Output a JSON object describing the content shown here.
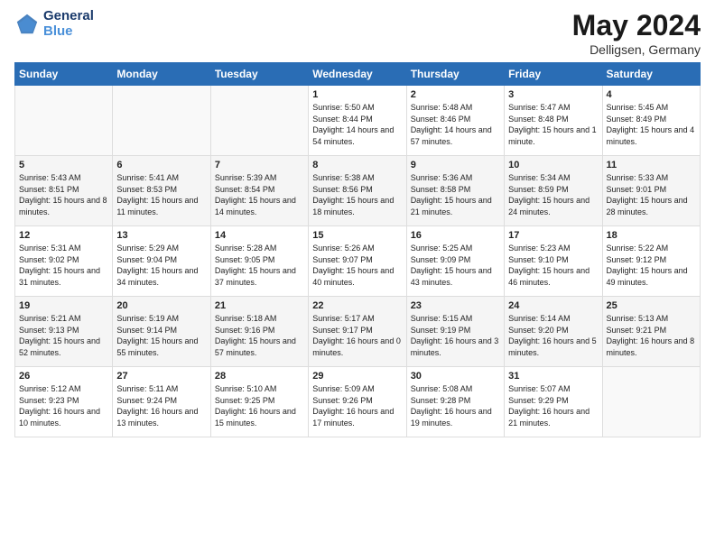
{
  "header": {
    "logo_line1": "General",
    "logo_line2": "Blue",
    "title": "May 2024",
    "subtitle": "Delligsen, Germany"
  },
  "days_of_week": [
    "Sunday",
    "Monday",
    "Tuesday",
    "Wednesday",
    "Thursday",
    "Friday",
    "Saturday"
  ],
  "weeks": [
    [
      {
        "num": "",
        "sunrise": "",
        "sunset": "",
        "daylight": ""
      },
      {
        "num": "",
        "sunrise": "",
        "sunset": "",
        "daylight": ""
      },
      {
        "num": "",
        "sunrise": "",
        "sunset": "",
        "daylight": ""
      },
      {
        "num": "1",
        "sunrise": "Sunrise: 5:50 AM",
        "sunset": "Sunset: 8:44 PM",
        "daylight": "Daylight: 14 hours and 54 minutes."
      },
      {
        "num": "2",
        "sunrise": "Sunrise: 5:48 AM",
        "sunset": "Sunset: 8:46 PM",
        "daylight": "Daylight: 14 hours and 57 minutes."
      },
      {
        "num": "3",
        "sunrise": "Sunrise: 5:47 AM",
        "sunset": "Sunset: 8:48 PM",
        "daylight": "Daylight: 15 hours and 1 minute."
      },
      {
        "num": "4",
        "sunrise": "Sunrise: 5:45 AM",
        "sunset": "Sunset: 8:49 PM",
        "daylight": "Daylight: 15 hours and 4 minutes."
      }
    ],
    [
      {
        "num": "5",
        "sunrise": "Sunrise: 5:43 AM",
        "sunset": "Sunset: 8:51 PM",
        "daylight": "Daylight: 15 hours and 8 minutes."
      },
      {
        "num": "6",
        "sunrise": "Sunrise: 5:41 AM",
        "sunset": "Sunset: 8:53 PM",
        "daylight": "Daylight: 15 hours and 11 minutes."
      },
      {
        "num": "7",
        "sunrise": "Sunrise: 5:39 AM",
        "sunset": "Sunset: 8:54 PM",
        "daylight": "Daylight: 15 hours and 14 minutes."
      },
      {
        "num": "8",
        "sunrise": "Sunrise: 5:38 AM",
        "sunset": "Sunset: 8:56 PM",
        "daylight": "Daylight: 15 hours and 18 minutes."
      },
      {
        "num": "9",
        "sunrise": "Sunrise: 5:36 AM",
        "sunset": "Sunset: 8:58 PM",
        "daylight": "Daylight: 15 hours and 21 minutes."
      },
      {
        "num": "10",
        "sunrise": "Sunrise: 5:34 AM",
        "sunset": "Sunset: 8:59 PM",
        "daylight": "Daylight: 15 hours and 24 minutes."
      },
      {
        "num": "11",
        "sunrise": "Sunrise: 5:33 AM",
        "sunset": "Sunset: 9:01 PM",
        "daylight": "Daylight: 15 hours and 28 minutes."
      }
    ],
    [
      {
        "num": "12",
        "sunrise": "Sunrise: 5:31 AM",
        "sunset": "Sunset: 9:02 PM",
        "daylight": "Daylight: 15 hours and 31 minutes."
      },
      {
        "num": "13",
        "sunrise": "Sunrise: 5:29 AM",
        "sunset": "Sunset: 9:04 PM",
        "daylight": "Daylight: 15 hours and 34 minutes."
      },
      {
        "num": "14",
        "sunrise": "Sunrise: 5:28 AM",
        "sunset": "Sunset: 9:05 PM",
        "daylight": "Daylight: 15 hours and 37 minutes."
      },
      {
        "num": "15",
        "sunrise": "Sunrise: 5:26 AM",
        "sunset": "Sunset: 9:07 PM",
        "daylight": "Daylight: 15 hours and 40 minutes."
      },
      {
        "num": "16",
        "sunrise": "Sunrise: 5:25 AM",
        "sunset": "Sunset: 9:09 PM",
        "daylight": "Daylight: 15 hours and 43 minutes."
      },
      {
        "num": "17",
        "sunrise": "Sunrise: 5:23 AM",
        "sunset": "Sunset: 9:10 PM",
        "daylight": "Daylight: 15 hours and 46 minutes."
      },
      {
        "num": "18",
        "sunrise": "Sunrise: 5:22 AM",
        "sunset": "Sunset: 9:12 PM",
        "daylight": "Daylight: 15 hours and 49 minutes."
      }
    ],
    [
      {
        "num": "19",
        "sunrise": "Sunrise: 5:21 AM",
        "sunset": "Sunset: 9:13 PM",
        "daylight": "Daylight: 15 hours and 52 minutes."
      },
      {
        "num": "20",
        "sunrise": "Sunrise: 5:19 AM",
        "sunset": "Sunset: 9:14 PM",
        "daylight": "Daylight: 15 hours and 55 minutes."
      },
      {
        "num": "21",
        "sunrise": "Sunrise: 5:18 AM",
        "sunset": "Sunset: 9:16 PM",
        "daylight": "Daylight: 15 hours and 57 minutes."
      },
      {
        "num": "22",
        "sunrise": "Sunrise: 5:17 AM",
        "sunset": "Sunset: 9:17 PM",
        "daylight": "Daylight: 16 hours and 0 minutes."
      },
      {
        "num": "23",
        "sunrise": "Sunrise: 5:15 AM",
        "sunset": "Sunset: 9:19 PM",
        "daylight": "Daylight: 16 hours and 3 minutes."
      },
      {
        "num": "24",
        "sunrise": "Sunrise: 5:14 AM",
        "sunset": "Sunset: 9:20 PM",
        "daylight": "Daylight: 16 hours and 5 minutes."
      },
      {
        "num": "25",
        "sunrise": "Sunrise: 5:13 AM",
        "sunset": "Sunset: 9:21 PM",
        "daylight": "Daylight: 16 hours and 8 minutes."
      }
    ],
    [
      {
        "num": "26",
        "sunrise": "Sunrise: 5:12 AM",
        "sunset": "Sunset: 9:23 PM",
        "daylight": "Daylight: 16 hours and 10 minutes."
      },
      {
        "num": "27",
        "sunrise": "Sunrise: 5:11 AM",
        "sunset": "Sunset: 9:24 PM",
        "daylight": "Daylight: 16 hours and 13 minutes."
      },
      {
        "num": "28",
        "sunrise": "Sunrise: 5:10 AM",
        "sunset": "Sunset: 9:25 PM",
        "daylight": "Daylight: 16 hours and 15 minutes."
      },
      {
        "num": "29",
        "sunrise": "Sunrise: 5:09 AM",
        "sunset": "Sunset: 9:26 PM",
        "daylight": "Daylight: 16 hours and 17 minutes."
      },
      {
        "num": "30",
        "sunrise": "Sunrise: 5:08 AM",
        "sunset": "Sunset: 9:28 PM",
        "daylight": "Daylight: 16 hours and 19 minutes."
      },
      {
        "num": "31",
        "sunrise": "Sunrise: 5:07 AM",
        "sunset": "Sunset: 9:29 PM",
        "daylight": "Daylight: 16 hours and 21 minutes."
      },
      {
        "num": "",
        "sunrise": "",
        "sunset": "",
        "daylight": ""
      }
    ]
  ]
}
